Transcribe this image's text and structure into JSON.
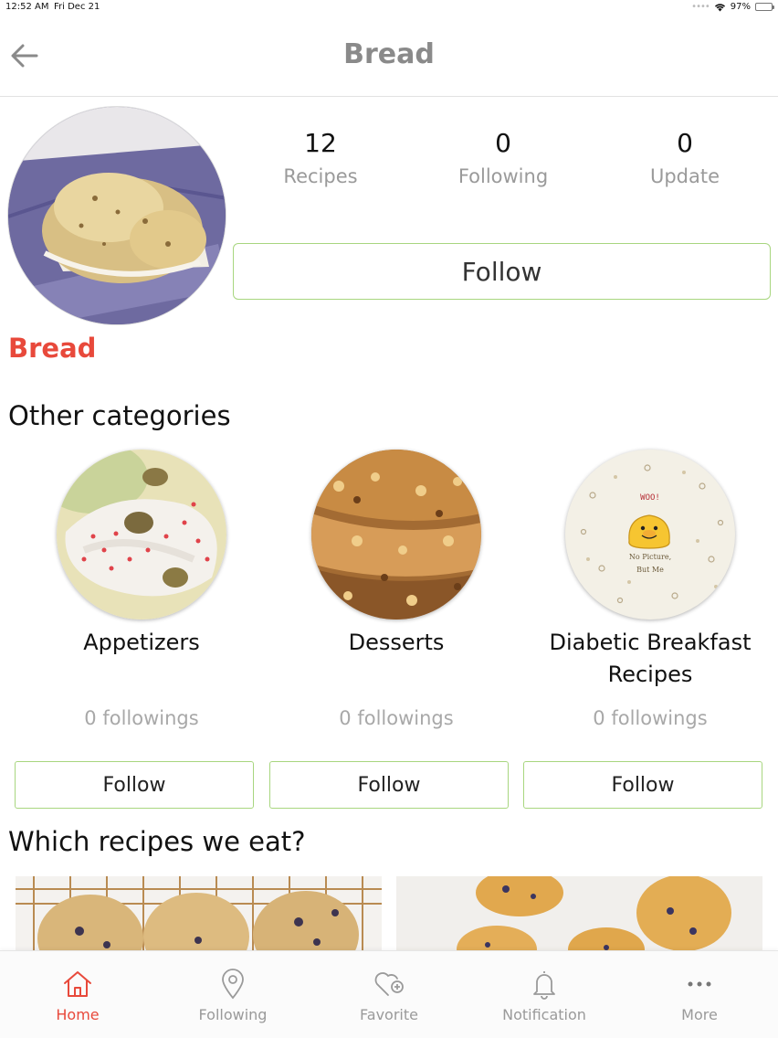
{
  "status_bar": {
    "time": "12:52 AM",
    "date": "Fri Dec 21",
    "battery": "97%"
  },
  "nav": {
    "title": "Bread"
  },
  "stats": [
    {
      "value": "12",
      "label": "Recipes"
    },
    {
      "value": "0",
      "label": "Following"
    },
    {
      "value": "0",
      "label": "Update"
    }
  ],
  "follow_label": "Follow",
  "profile_name": "Bread",
  "other_categories": {
    "title": "Other categories",
    "items": [
      {
        "name": "Appetizers",
        "followings": "0 followings",
        "follow_label": "Follow"
      },
      {
        "name": "Desserts",
        "followings": "0 followings",
        "follow_label": "Follow"
      },
      {
        "name": "Diabetic Breakfast Recipes",
        "followings": "0 followings",
        "follow_label": "Follow",
        "placeholder_title": "WOO!",
        "placeholder_line1": "No Picture,",
        "placeholder_line2": "But Me"
      }
    ]
  },
  "which_recipes_title": "Which recipes we eat?",
  "tabs": [
    {
      "label": "Home",
      "icon": "home-icon",
      "active": true
    },
    {
      "label": "Following",
      "icon": "location-pin-icon"
    },
    {
      "label": "Favorite",
      "icon": "heart-plus-icon"
    },
    {
      "label": "Notification",
      "icon": "bell-icon"
    },
    {
      "label": "More",
      "icon": "more-dots-icon"
    }
  ],
  "colors": {
    "accent": "#e8493b",
    "button_border": "#a8d67f",
    "muted": "#9a9a9a"
  }
}
